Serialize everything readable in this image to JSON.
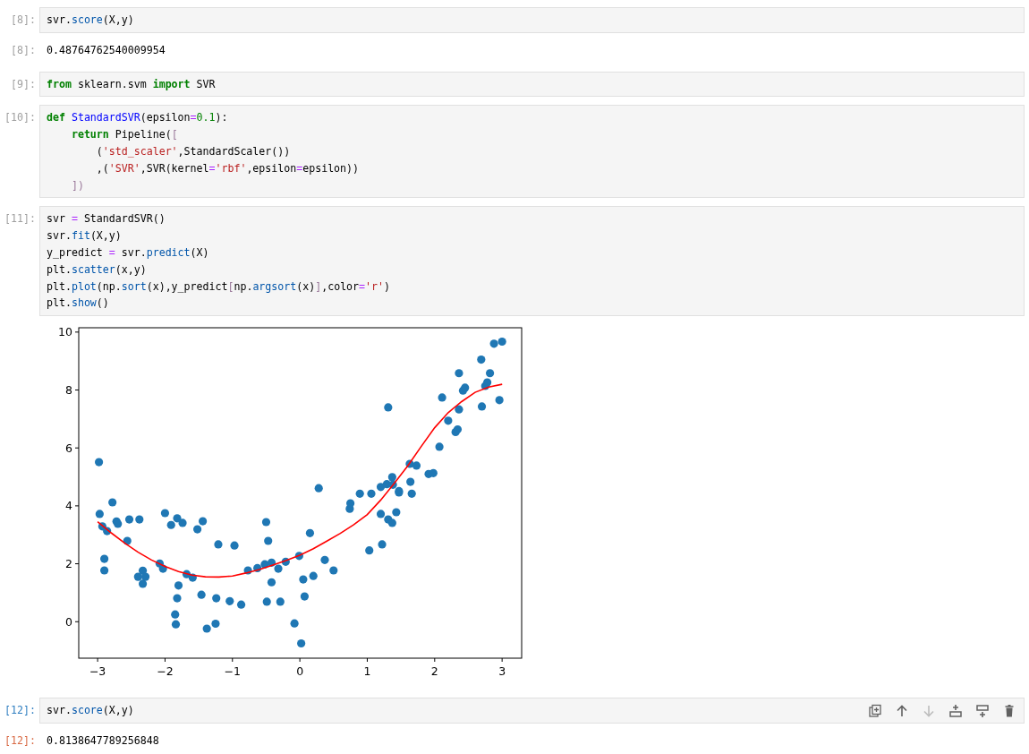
{
  "cells": [
    {
      "prompt": "[8]:",
      "selected": false,
      "lines": [
        [
          {
            "kind": "plain",
            "text": "svr."
          },
          {
            "kind": "property",
            "text": "score"
          },
          {
            "kind": "plain",
            "text": "(X,y)"
          }
        ]
      ],
      "outputs": [
        {
          "kind": "text",
          "prompt": "[8]:",
          "text": "0.48764762540009954"
        }
      ]
    },
    {
      "prompt": "[9]:",
      "selected": false,
      "lines": [
        [
          {
            "kind": "keyword",
            "text": "from"
          },
          {
            "kind": "plain",
            "text": " sklearn.svm "
          },
          {
            "kind": "keyword",
            "text": "import"
          },
          {
            "kind": "plain",
            "text": " SVR"
          }
        ]
      ]
    },
    {
      "prompt": "[10]:",
      "selected": false,
      "lines": [
        [
          {
            "kind": "keyword",
            "text": "def "
          },
          {
            "kind": "definition",
            "text": "StandardSVR"
          },
          {
            "kind": "plain",
            "text": "(epsilon"
          },
          {
            "kind": "operator",
            "text": "="
          },
          {
            "kind": "number",
            "text": "0.1"
          },
          {
            "kind": "plain",
            "text": "):"
          }
        ],
        [
          {
            "kind": "keyword",
            "text": "    return"
          },
          {
            "kind": "plain",
            "text": " Pipeline("
          },
          {
            "kind": "bracket",
            "text": "["
          }
        ],
        [
          {
            "kind": "plain",
            "text": "        ("
          },
          {
            "kind": "string",
            "text": "'std_scaler'"
          },
          {
            "kind": "plain",
            "text": ",StandardScaler())"
          }
        ],
        [
          {
            "kind": "plain",
            "text": "        ,("
          },
          {
            "kind": "string",
            "text": "'SVR'"
          },
          {
            "kind": "plain",
            "text": ",SVR(kernel"
          },
          {
            "kind": "operator",
            "text": "="
          },
          {
            "kind": "string",
            "text": "'rbf'"
          },
          {
            "kind": "plain",
            "text": ",epsilon"
          },
          {
            "kind": "operator",
            "text": "="
          },
          {
            "kind": "plain",
            "text": "epsilon))"
          }
        ],
        [
          {
            "kind": "bracket",
            "text": "    ])"
          }
        ]
      ]
    },
    {
      "prompt": "[11]:",
      "selected": false,
      "lines": [
        [
          {
            "kind": "plain",
            "text": "svr "
          },
          {
            "kind": "operator",
            "text": "="
          },
          {
            "kind": "plain",
            "text": " StandardSVR()"
          }
        ],
        [
          {
            "kind": "plain",
            "text": "svr."
          },
          {
            "kind": "property",
            "text": "fit"
          },
          {
            "kind": "plain",
            "text": "(X,y)"
          }
        ],
        [
          {
            "kind": "plain",
            "text": "y_predict "
          },
          {
            "kind": "operator",
            "text": "="
          },
          {
            "kind": "plain",
            "text": " svr."
          },
          {
            "kind": "property",
            "text": "predict"
          },
          {
            "kind": "plain",
            "text": "(X)"
          }
        ],
        [
          {
            "kind": "plain",
            "text": "plt."
          },
          {
            "kind": "property",
            "text": "scatter"
          },
          {
            "kind": "plain",
            "text": "(x,y)"
          }
        ],
        [
          {
            "kind": "plain",
            "text": "plt."
          },
          {
            "kind": "property",
            "text": "plot"
          },
          {
            "kind": "plain",
            "text": "(np."
          },
          {
            "kind": "property",
            "text": "sort"
          },
          {
            "kind": "plain",
            "text": "(x),y_predict"
          },
          {
            "kind": "bracket",
            "text": "["
          },
          {
            "kind": "plain",
            "text": "np."
          },
          {
            "kind": "property",
            "text": "argsort"
          },
          {
            "kind": "plain",
            "text": "(x)"
          },
          {
            "kind": "bracket",
            "text": "]"
          },
          {
            "kind": "plain",
            "text": ",color"
          },
          {
            "kind": "operator",
            "text": "="
          },
          {
            "kind": "string",
            "text": "'r'"
          },
          {
            "kind": "plain",
            "text": ")"
          }
        ],
        [
          {
            "kind": "plain",
            "text": "plt."
          },
          {
            "kind": "property",
            "text": "show"
          },
          {
            "kind": "plain",
            "text": "()"
          }
        ]
      ],
      "outputs": [
        {
          "kind": "plot",
          "chart_data": {
            "type": "scatter",
            "xlim": [
              -3.28,
              3.29
            ],
            "ylim": [
              -1.26,
              10.15
            ],
            "xticks": [
              {
                "value": -3,
                "label": "−3"
              },
              {
                "value": -2,
                "label": "−2"
              },
              {
                "value": -1,
                "label": "−1"
              },
              0,
              1,
              2,
              3
            ],
            "yticks": [
              0,
              2,
              4,
              6,
              8,
              10
            ],
            "series": [
              {
                "type": "scatter",
                "color": "#1f77b4",
                "x": [
                  -2.98,
                  -2.97,
                  -2.93,
                  -2.86,
                  -2.9,
                  -2.9,
                  -2.78,
                  -2.72,
                  -2.7,
                  -2.56,
                  -2.53,
                  -2.38,
                  -2.4,
                  -2.33,
                  -2.29,
                  -2.33,
                  -2.08,
                  -2.03,
                  -2.0,
                  -1.91,
                  -1.82,
                  -1.74,
                  -1.8,
                  -1.82,
                  -1.85,
                  -1.84,
                  -1.68,
                  -1.59,
                  -1.52,
                  -1.44,
                  -1.46,
                  -1.38,
                  -1.25,
                  -1.24,
                  -1.21,
                  -1.04,
                  -0.97,
                  -0.87,
                  -0.77,
                  -0.63,
                  -0.52,
                  -0.5,
                  -0.47,
                  -0.42,
                  -0.42,
                  -0.49,
                  -0.32,
                  -0.29,
                  -0.21,
                  -0.08,
                  -0.01,
                  0.02,
                  0.05,
                  0.07,
                  0.15,
                  0.2,
                  0.28,
                  0.37,
                  0.5,
                  0.74,
                  0.75,
                  0.89,
                  1.03,
                  1.06,
                  1.2,
                  1.2,
                  1.22,
                  1.29,
                  1.31,
                  1.31,
                  1.37,
                  1.37,
                  1.38,
                  1.43,
                  1.47,
                  1.47,
                  1.63,
                  1.64,
                  1.66,
                  1.73,
                  1.91,
                  1.98,
                  2.07,
                  2.11,
                  2.2,
                  2.31,
                  2.34,
                  2.36,
                  2.36,
                  2.42,
                  2.45,
                  2.69,
                  2.7,
                  2.75,
                  2.78,
                  2.82,
                  2.88,
                  2.96,
                  3.0
                ],
                "values": [
                  5.51,
                  3.72,
                  3.29,
                  3.13,
                  2.17,
                  1.77,
                  4.12,
                  3.46,
                  3.38,
                  2.79,
                  3.53,
                  3.53,
                  1.55,
                  1.76,
                  1.55,
                  1.31,
                  2.01,
                  1.83,
                  3.75,
                  3.34,
                  3.57,
                  3.41,
                  1.25,
                  0.81,
                  0.25,
                  -0.09,
                  1.64,
                  1.52,
                  3.19,
                  3.47,
                  0.93,
                  -0.24,
                  -0.07,
                  0.81,
                  2.67,
                  0.71,
                  2.63,
                  0.59,
                  1.77,
                  1.85,
                  1.98,
                  3.44,
                  2.79,
                  2.04,
                  1.36,
                  0.69,
                  1.83,
                  0.69,
                  2.07,
                  -0.06,
                  2.27,
                  -0.75,
                  1.46,
                  0.87,
                  3.06,
                  1.58,
                  4.61,
                  2.13,
                  1.77,
                  3.9,
                  4.09,
                  4.42,
                  2.46,
                  4.42,
                  4.65,
                  3.72,
                  2.67,
                  4.75,
                  7.4,
                  3.53,
                  3.41,
                  4.99,
                  4.73,
                  3.78,
                  4.51,
                  4.46,
                  5.45,
                  4.83,
                  4.42,
                  5.39,
                  5.1,
                  5.13,
                  6.04,
                  7.74,
                  6.94,
                  6.55,
                  6.64,
                  7.33,
                  8.58,
                  7.98,
                  8.08,
                  9.05,
                  7.43,
                  8.14,
                  8.26,
                  8.58,
                  9.6,
                  7.65,
                  9.67
                ]
              },
              {
                "type": "line",
                "color": "#ff0000",
                "x": [
                  -3.0,
                  -2.8,
                  -2.6,
                  -2.4,
                  -2.2,
                  -2.0,
                  -1.8,
                  -1.6,
                  -1.4,
                  -1.2,
                  -1.0,
                  -0.8,
                  -0.6,
                  -0.4,
                  -0.2,
                  0.0,
                  0.2,
                  0.4,
                  0.6,
                  0.8,
                  1.0,
                  1.2,
                  1.4,
                  1.6,
                  1.8,
                  2.0,
                  2.2,
                  2.4,
                  2.6,
                  2.8,
                  3.0
                ],
                "values": [
                  3.45,
                  3.07,
                  2.72,
                  2.4,
                  2.13,
                  1.91,
                  1.73,
                  1.61,
                  1.55,
                  1.54,
                  1.58,
                  1.68,
                  1.8,
                  1.96,
                  2.12,
                  2.3,
                  2.52,
                  2.78,
                  3.05,
                  3.35,
                  3.7,
                  4.2,
                  4.78,
                  5.38,
                  6.05,
                  6.7,
                  7.22,
                  7.6,
                  7.92,
                  8.1,
                  8.2
                ]
              }
            ]
          }
        }
      ]
    },
    {
      "prompt": "[12]:",
      "selected": true,
      "lines": [
        [
          {
            "kind": "plain",
            "text": "svr."
          },
          {
            "kind": "property",
            "text": "score"
          },
          {
            "kind": "plain",
            "text": "(X,y)"
          }
        ]
      ],
      "toolbar": [
        {
          "kind": "duplicate",
          "disabled": false
        },
        {
          "kind": "move-up",
          "disabled": false
        },
        {
          "kind": "move-down",
          "disabled": true
        },
        {
          "kind": "insert-above",
          "disabled": false
        },
        {
          "kind": "insert-below",
          "disabled": false
        },
        {
          "kind": "delete",
          "disabled": false
        }
      ],
      "outputs": [
        {
          "kind": "text",
          "prompt": "[12]:",
          "text": "0.8138647789256848"
        }
      ]
    }
  ]
}
